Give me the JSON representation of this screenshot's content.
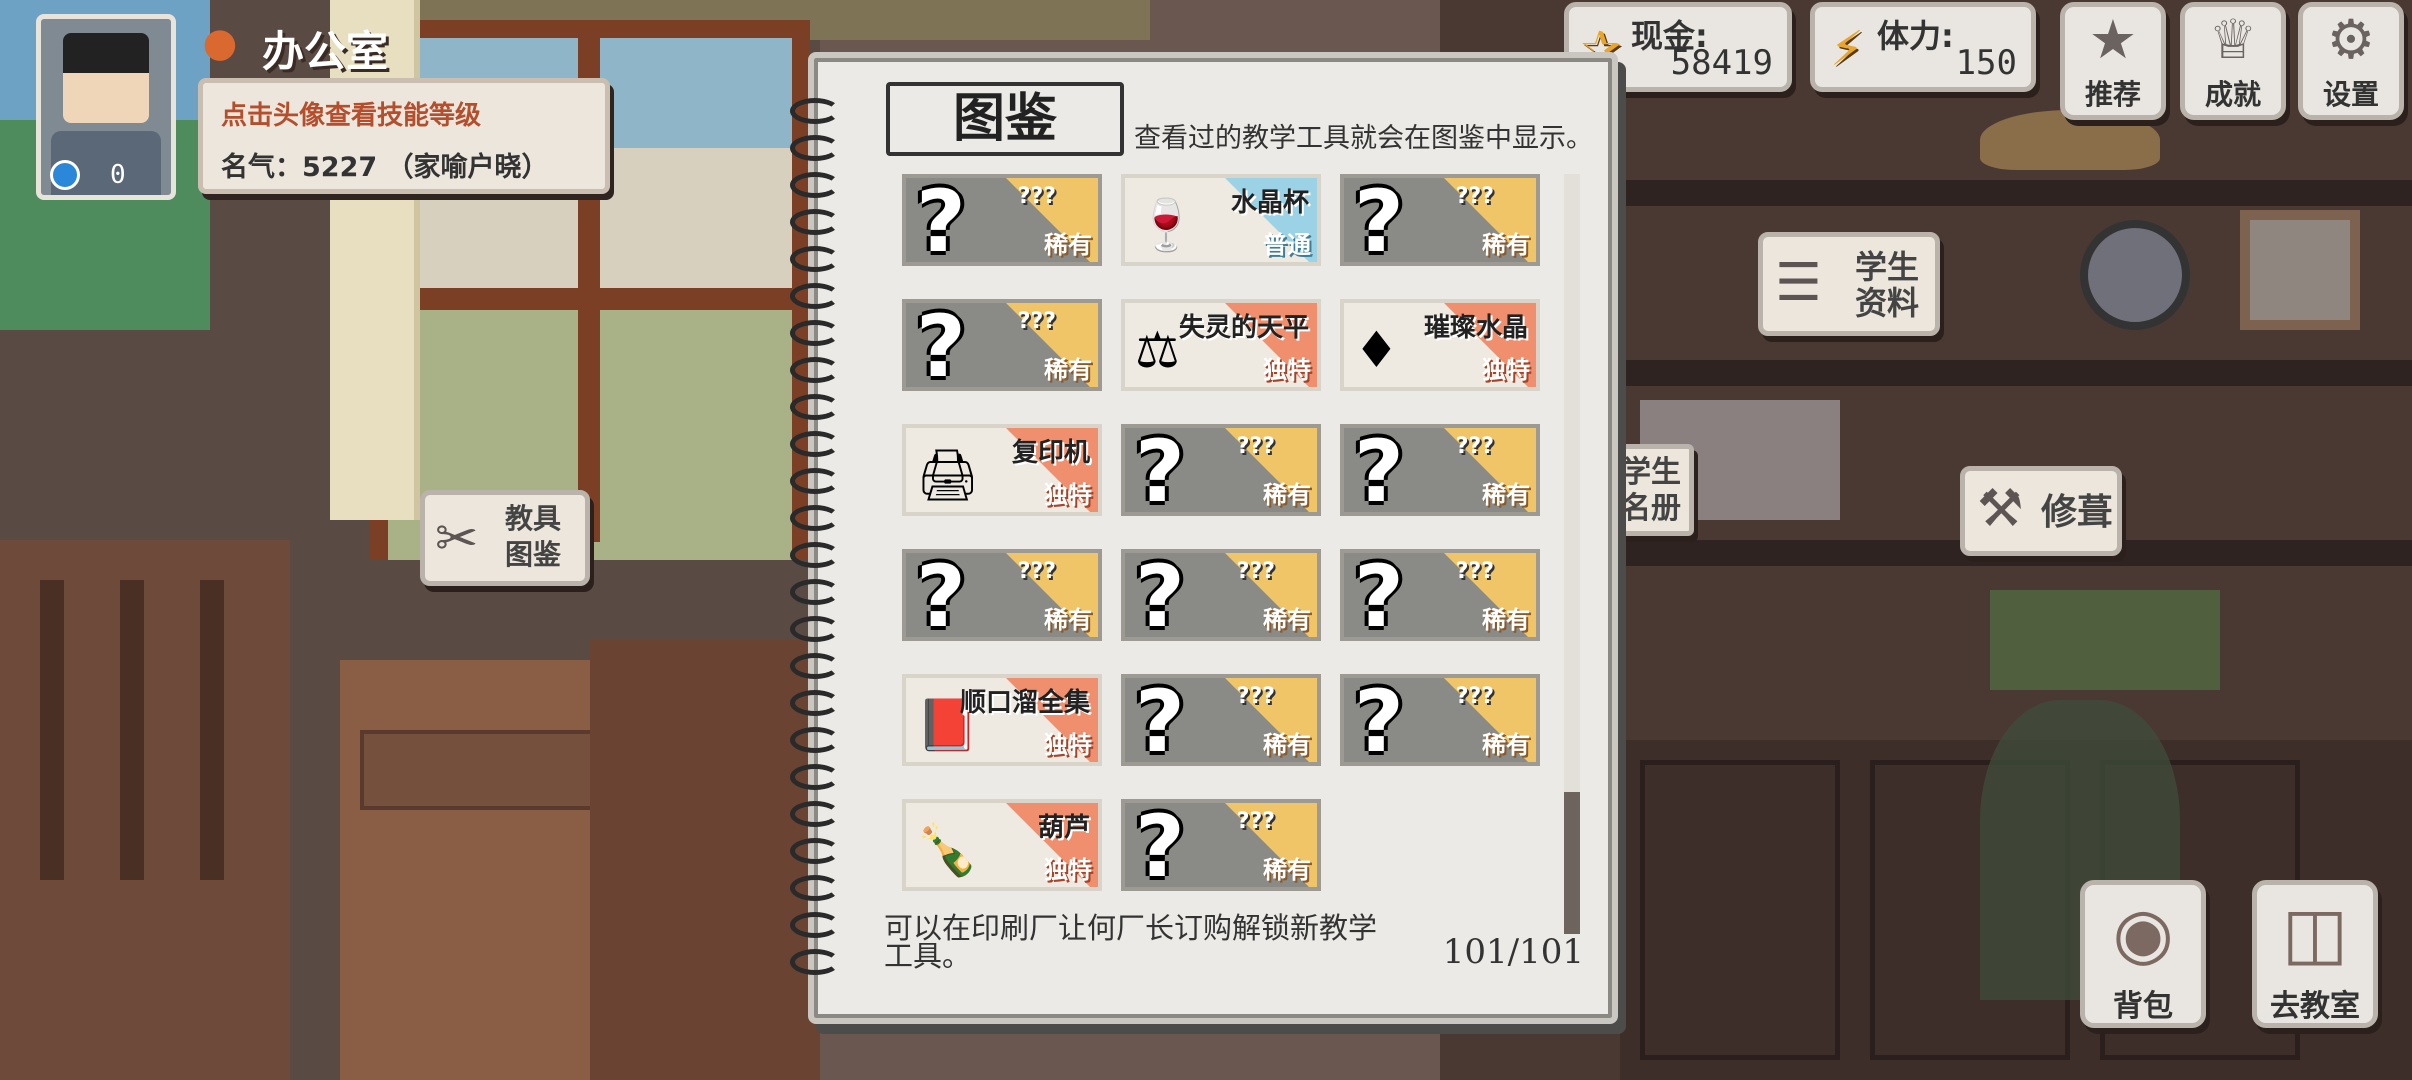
{
  "header": {
    "location": "办公室",
    "avatar_count": "0",
    "hint": "点击头像查看技能等级",
    "fame": "名气：5227 （家喻户晓）"
  },
  "stats": {
    "cash_label": "现金:",
    "cash_value": "58419",
    "stamina_label": "体力:",
    "stamina_value": "150"
  },
  "top_buttons": {
    "recommend": "推荐",
    "achievements": "成就",
    "settings": "设置"
  },
  "bubbles": {
    "tools": "教具\n图鉴",
    "student_info": "学生\n资料",
    "roster": "学生\n名册",
    "repair": "修葺"
  },
  "bottom_buttons": {
    "bag": "背包",
    "classroom": "去教室"
  },
  "notebook": {
    "title": "图鉴",
    "desc": "查看过的教学工具就会在图鉴中显示。",
    "footer": "可以在印刷厂让何厂长订购解锁新教学工具。",
    "count": "101/101",
    "cards": [
      {
        "name": "???",
        "rarity": "稀有",
        "icon": "question-mark"
      },
      {
        "name": "水晶杯",
        "rarity": "普通",
        "icon": "goblet"
      },
      {
        "name": "???",
        "rarity": "稀有",
        "icon": "question-mark"
      },
      {
        "name": "???",
        "rarity": "稀有",
        "icon": "question-mark"
      },
      {
        "name": "失灵的天平",
        "rarity": "独特",
        "icon": "scale"
      },
      {
        "name": "璀璨水晶",
        "rarity": "独特",
        "icon": "crystal"
      },
      {
        "name": "复印机",
        "rarity": "独特",
        "icon": "copier"
      },
      {
        "name": "???",
        "rarity": "稀有",
        "icon": "question-mark"
      },
      {
        "name": "???",
        "rarity": "稀有",
        "icon": "question-mark"
      },
      {
        "name": "???",
        "rarity": "稀有",
        "icon": "question-mark"
      },
      {
        "name": "???",
        "rarity": "稀有",
        "icon": "question-mark"
      },
      {
        "name": "???",
        "rarity": "稀有",
        "icon": "question-mark"
      },
      {
        "name": "顺口溜全集",
        "rarity": "独特",
        "icon": "book"
      },
      {
        "name": "???",
        "rarity": "稀有",
        "icon": "question-mark"
      },
      {
        "name": "???",
        "rarity": "稀有",
        "icon": "question-mark"
      },
      {
        "name": "葫芦",
        "rarity": "独特",
        "icon": "gourd"
      },
      {
        "name": "???",
        "rarity": "稀有",
        "icon": "question-mark"
      }
    ]
  },
  "colors": {
    "rare": "#f0c567",
    "common": "#9cd2e6",
    "unique": "#ef8f6e",
    "hint_text": "#b44e2c"
  }
}
